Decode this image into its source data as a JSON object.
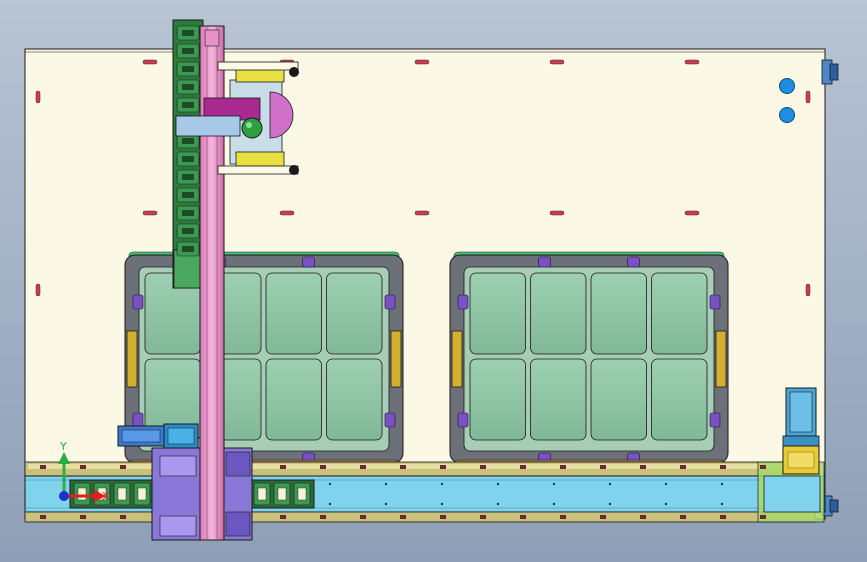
{
  "viewport": {
    "background_top": "#b9c4d4",
    "background_bottom": "#8e9fb7"
  },
  "colors": {
    "base_plate": "#fbf8e6",
    "outline": "#1a1a1a",
    "tray_fill": "#8fc4a4",
    "tray_frame": "#6c7078",
    "conveyor": "#7fd3ec",
    "gantry_pink": "#f0a0d0",
    "purple": "#7a50c8",
    "blue_button": "#1e8fe0",
    "cable_chain": "#3a8a4a",
    "motor_yellow": "#e8cc36",
    "red_slot": "#c84050"
  },
  "triad": {
    "y_label": "Y",
    "x_label": "X",
    "y_color": "#2ab040",
    "x_color": "#e02020",
    "origin_color": "#2030d0"
  },
  "trays": [
    {
      "id": "tray-left",
      "columns": 4,
      "rows": 2
    },
    {
      "id": "tray-right",
      "columns": 4,
      "rows": 2
    }
  ],
  "buttons": [
    {
      "id": "button-top"
    },
    {
      "id": "button-bottom"
    }
  ]
}
